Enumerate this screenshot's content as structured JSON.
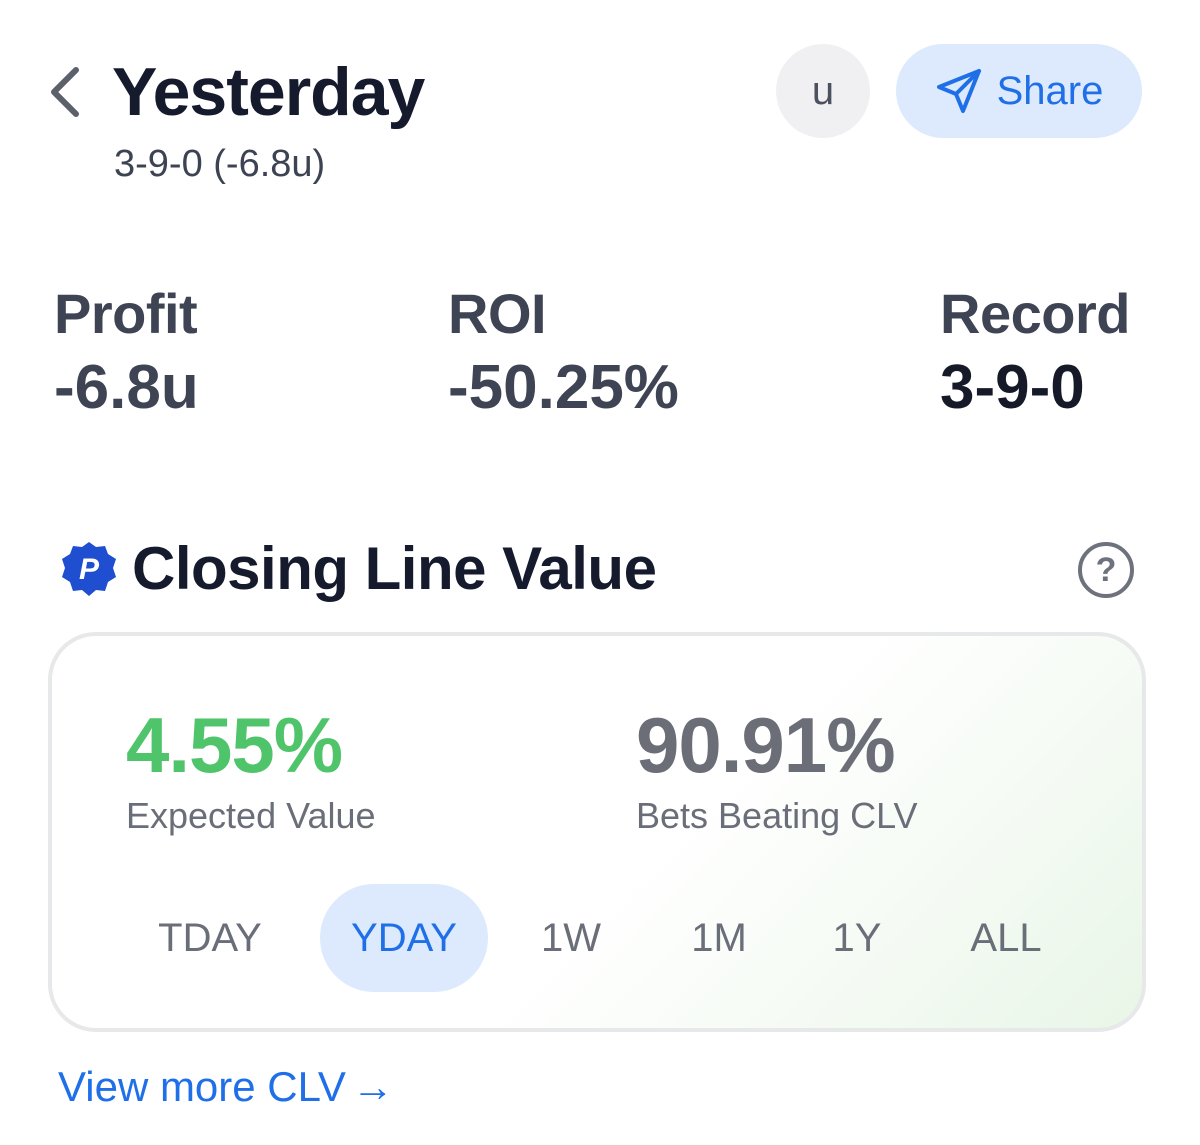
{
  "header": {
    "title": "Yesterday",
    "subtitle": "3-9-0 (-6.8u)",
    "avatar_letter": "u",
    "share_label": "Share"
  },
  "stats": [
    {
      "label": "Profit",
      "value": "-6.8u"
    },
    {
      "label": "ROI",
      "value": "-50.25%"
    },
    {
      "label": "Record",
      "value": "3-9-0"
    }
  ],
  "clv": {
    "logo_letter": "P",
    "title": "Closing Line Value",
    "help_symbol": "?",
    "expected_value": "4.55%",
    "expected_value_label": "Expected Value",
    "bets_beating": "90.91%",
    "bets_beating_label": "Bets Beating CLV",
    "tabs": [
      "TDAY",
      "YDAY",
      "1W",
      "1M",
      "1Y",
      "ALL"
    ],
    "active_tab": "YDAY"
  },
  "footer": {
    "view_more": "View more CLV",
    "arrow": "→"
  },
  "colors": {
    "accent": "#1f6fe8",
    "accent_bg": "#dde9fc",
    "positive": "#4fc46b",
    "logo_blue": "#1f4fd0"
  },
  "icons": {
    "back": "chevron-left-icon",
    "share": "paper-plane-icon",
    "help": "question-circle-icon",
    "logo": "badge-p-icon"
  }
}
